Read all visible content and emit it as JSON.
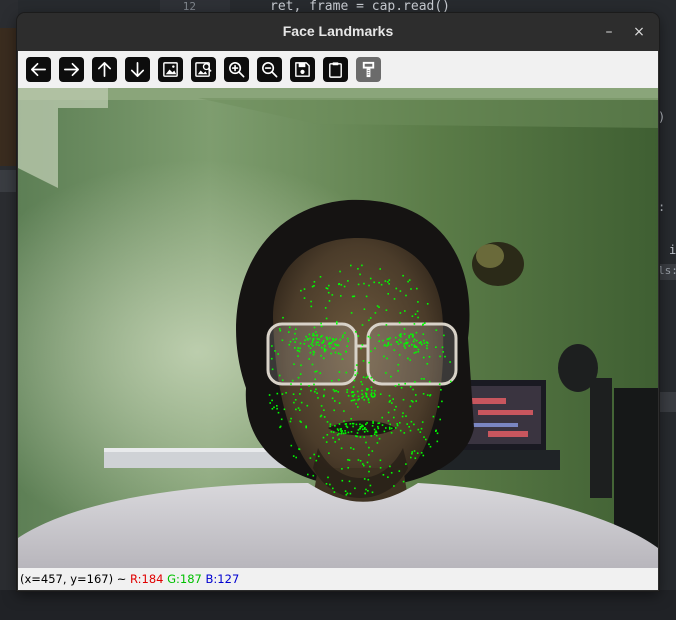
{
  "window": {
    "title": "Face Landmarks"
  },
  "editor": {
    "line_number": "12",
    "code_line": "ret, frame = cap.read()",
    "right_glyphs": [
      ")",
      ":",
      "i",
      "ls:"
    ]
  },
  "window_controls": {
    "minimize": "–",
    "close": "×"
  },
  "toolbar": {
    "buttons": [
      {
        "icon": "arrow-left-icon"
      },
      {
        "icon": "arrow-right-icon"
      },
      {
        "icon": "arrow-up-icon"
      },
      {
        "icon": "arrow-down-icon"
      },
      {
        "icon": "image-icon"
      },
      {
        "icon": "image-zoom-icon"
      },
      {
        "icon": "zoom-in-icon"
      },
      {
        "icon": "zoom-out-icon"
      },
      {
        "icon": "save-icon"
      },
      {
        "icon": "clipboard-icon"
      },
      {
        "icon": "properties-icon"
      }
    ]
  },
  "video": {
    "landmark_color": "#00ff00"
  },
  "status": {
    "coords": "(x=457, y=167) ~",
    "r": "R:184",
    "g": "G:187",
    "b": "B:127",
    "r_color": "#e00000",
    "g_color": "#00c000",
    "b_color": "#0000d0"
  }
}
